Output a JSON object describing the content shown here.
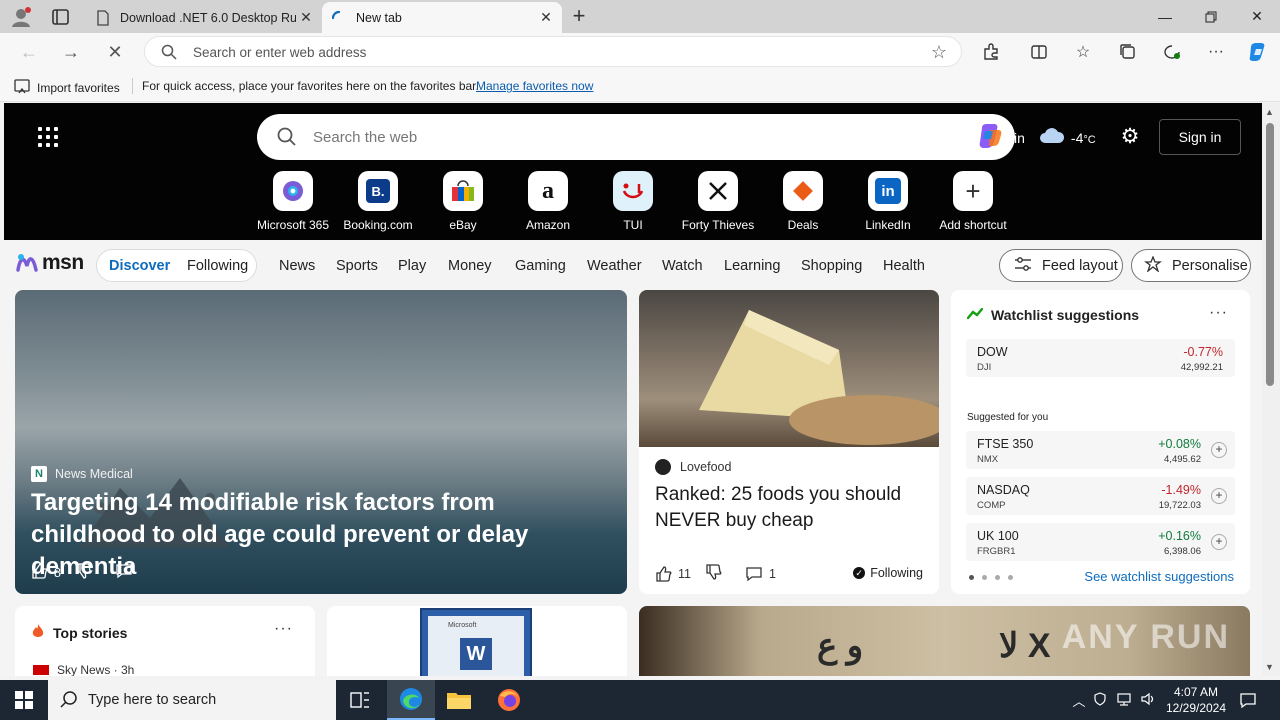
{
  "browser": {
    "tabs": [
      {
        "title": "Download .NET 6.0 Desktop Runtime"
      },
      {
        "title": "New tab"
      }
    ],
    "address_placeholder": "Search or enter web address",
    "favorites": {
      "import_label": "Import favorites",
      "message": "For quick access, place your favorites here on the favorites bar.",
      "manage_link": "Manage favorites now"
    }
  },
  "msn": {
    "search_placeholder": "Search the web",
    "weather": {
      "location": "in",
      "temp": "-4",
      "unit": "°C"
    },
    "sign_in": "Sign in",
    "shortcuts": [
      {
        "label": "Microsoft 365"
      },
      {
        "label": "Booking.com"
      },
      {
        "label": "eBay"
      },
      {
        "label": "Amazon"
      },
      {
        "label": "TUI"
      },
      {
        "label": "Forty Thieves"
      },
      {
        "label": "Deals"
      },
      {
        "label": "LinkedIn"
      },
      {
        "label": "Add shortcut"
      }
    ],
    "logo": "msn",
    "pills": {
      "discover": "Discover",
      "following": "Following"
    },
    "nav": [
      "News",
      "Sports",
      "Play",
      "Money",
      "Gaming",
      "Weather",
      "Watch",
      "Learning",
      "Shopping",
      "Health"
    ],
    "feed_layout": "Feed layout",
    "personalise": "Personalise"
  },
  "hero": {
    "source": "News Medical",
    "headline": "Targeting 14 modifiable risk factors from childhood to old age could prevent or delay dementia",
    "likes": "8"
  },
  "food_card": {
    "source": "Lovefood",
    "headline": "Ranked: 25 foods you should NEVER buy cheap",
    "likes": "11",
    "comments": "1",
    "following_label": "Following"
  },
  "watchlist": {
    "title": "Watchlist suggestions",
    "main": {
      "name": "DOW",
      "sub": "DJI",
      "change": "-0.77%",
      "value": "42,992.21"
    },
    "suggested_label": "Suggested for you",
    "suggested": [
      {
        "name": "FTSE 350",
        "sub": "NMX",
        "change": "+0.08%",
        "value": "4,495.62",
        "trend": "pos"
      },
      {
        "name": "NASDAQ",
        "sub": "COMP",
        "change": "-1.49%",
        "value": "19,722.03",
        "trend": "neg"
      },
      {
        "name": "UK 100",
        "sub": "FRGBR1",
        "change": "+0.16%",
        "value": "6,398.06",
        "trend": "pos"
      }
    ],
    "see_all": "See watchlist suggestions"
  },
  "top_stories": {
    "title": "Top stories",
    "source": "Sky News · 3h"
  },
  "word_card": {
    "brand": "Microsoft",
    "letter": "W"
  },
  "sign_card": {
    "text_left": "ﻭ ﻉ",
    "text_right": "ﻻ X",
    "watermark": "ANY RUN"
  },
  "taskbar": {
    "search_placeholder": "Type here to search",
    "time": "4:07 AM",
    "date": "12/29/2024"
  },
  "colors": {
    "accent": "#0f6cbd",
    "negative": "#c0262d",
    "positive": "#0f7b3c"
  }
}
